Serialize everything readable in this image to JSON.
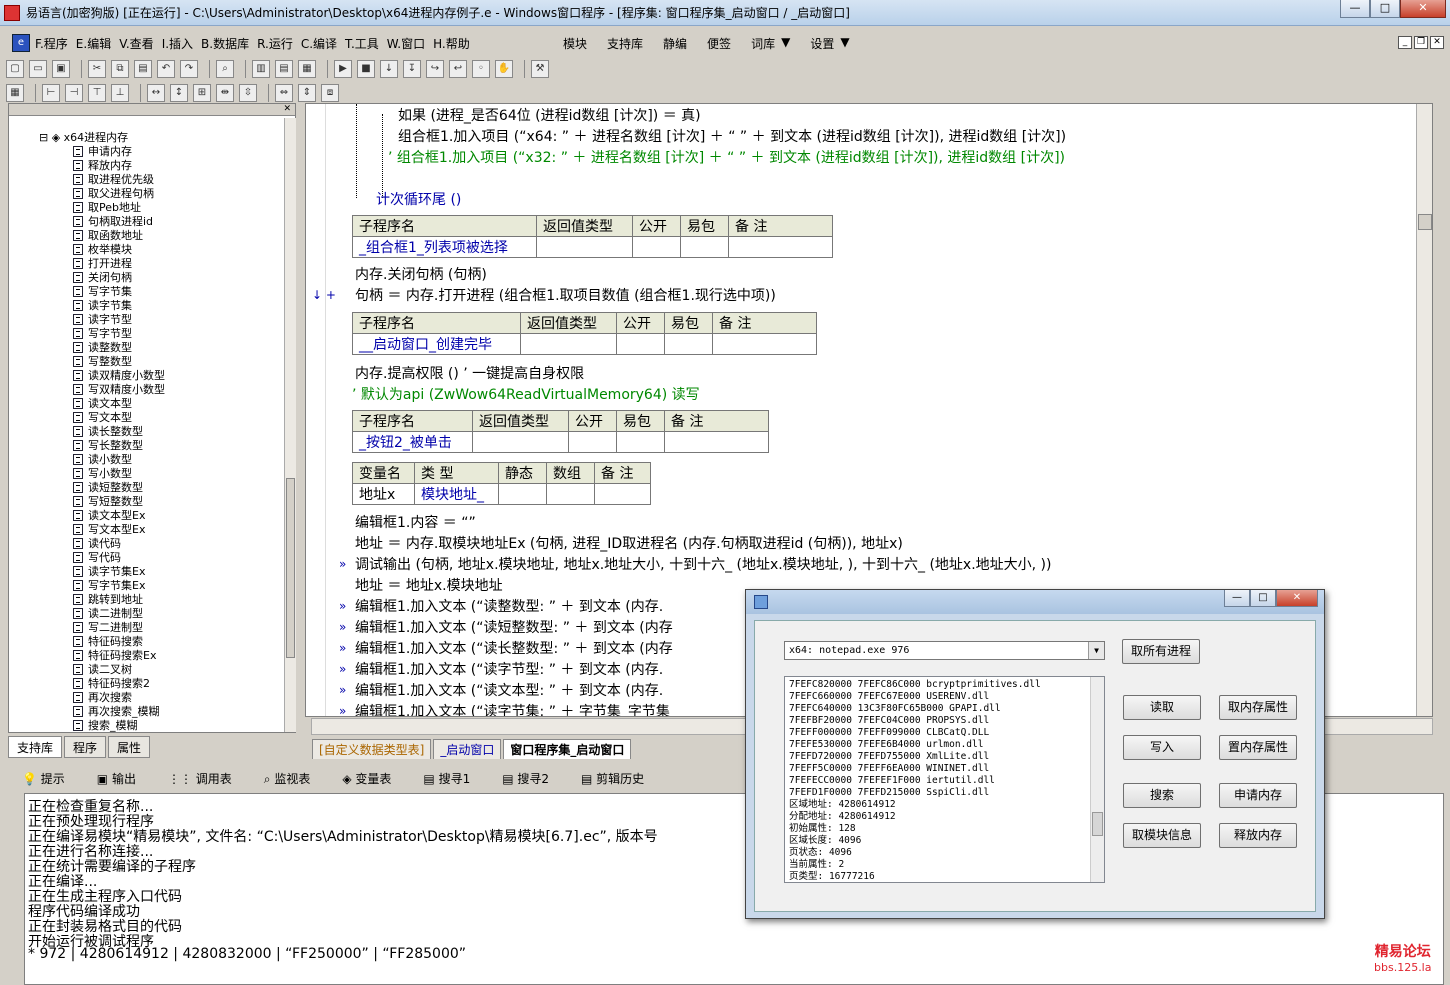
{
  "window": {
    "title": "易语言(加密狗版) [正在运行] - C:\\Users\\Administrator\\Desktop\\x64进程内存例子.e - Windows窗口程序 - [程序集: 窗口程序集_启动窗口 / _启动窗口]",
    "min": "—",
    "max": "□",
    "close": "✕"
  },
  "menu": {
    "items": [
      "F.程序",
      "E.编辑",
      "V.查看",
      "I.插入",
      "B.数据库",
      "R.运行",
      "C.编译",
      "T.工具",
      "W.窗口",
      "H.帮助"
    ],
    "right": [
      "模块",
      "支持库",
      "静编",
      "便签",
      "词库",
      "设置"
    ]
  },
  "sidebar": {
    "root": "x64进程内存",
    "items": [
      "申请内存",
      "释放内存",
      "取进程优先级",
      "取父进程句柄",
      "取Peb地址",
      "句柄取进程id",
      "取函数地址",
      "枚举模块",
      "打开进程",
      "关闭句柄",
      "写字节集",
      "读字节集",
      "读字节型",
      "写字节型",
      "读整数型",
      "写整数型",
      "读双精度小数型",
      "写双精度小数型",
      "读文本型",
      "写文本型",
      "读长整数型",
      "写长整数型",
      "读小数型",
      "写小数型",
      "读短整数型",
      "写短整数型",
      "读文本型Ex",
      "写文本型Ex",
      "读代码",
      "写代码",
      "读字节集Ex",
      "写字节集Ex",
      "跳转到地址",
      "读二进制型",
      "写二进制型",
      "特征码搜索",
      "特征码搜索Ex",
      "读二叉树",
      "特征码搜索2",
      "再次搜索",
      "再次搜索_模糊",
      "搜索_模糊"
    ],
    "tabs": [
      "支持库",
      "程序",
      "属性"
    ]
  },
  "editor": {
    "tabs": [
      "[自定义数据类型表]",
      "_启动窗口",
      "窗口程序集_启动窗口"
    ],
    "headers1": [
      "子程序名",
      "返回值类型",
      "公开",
      "易包",
      "备 注"
    ],
    "headers2": [
      "变量名",
      "类 型",
      "静态",
      "数组",
      "备 注"
    ],
    "sub1": "_组合框1_列表项被选择",
    "sub2": "__启动窗口_创建完毕",
    "sub3": "_按钮2_被单击",
    "var_name": "地址x",
    "var_type": "模块地址_",
    "l_if": "如果 (进程_是否64位 (进程id数组 [计次]) ＝ 真)",
    "l_add1": "组合框1.加入项目 (“x64: ” ＋ 进程名数组 [计次] ＋ “  ” ＋ 到文本 (进程id数组 [计次]), 进程id数组 [计次])",
    "l_add2": "’ 组合框1.加入项目 (“x32: ” ＋ 进程名数组 [计次] ＋ “  ” ＋ 到文本 (进程id数组 [计次]), 进程id数组 [计次])",
    "l_loop": "计次循环尾 ()",
    "l_close": "内存.关闭句柄 (句柄)",
    "l_open": "句柄 ＝ 内存.打开进程 (组合框1.取项目数值 (组合框1.现行选中项))",
    "l_priv": "内存.提高权限 () ’ 一键提高自身权限",
    "l_api": "’ 默认为api (ZwWow64ReadVirtualMemory64) 读写",
    "l_e1": "编辑框1.内容 ＝ “”",
    "l_e2": "地址 ＝ 内存.取模块地址Ex (句柄, 进程_ID取进程名 (内存.句柄取进程id (句柄)), 地址x)",
    "l_e3": "调试输出 (句柄, 地址x.模块地址, 地址x.地址大小, 十到十六_ (地址x.模块地址, ), 十到十六_ (地址x.地址大小, ))",
    "l_e4": "地址 ＝ 地址x.模块地址",
    "l_e5": "编辑框1.加入文本 (“读整数型: ” ＋ 到文本 (内存.",
    "l_e6": "编辑框1.加入文本 (“读短整数型: ” ＋ 到文本 (内存",
    "l_e7": "编辑框1.加入文本 (“读长整数型: ” ＋ 到文本 (内存",
    "l_e8": "编辑框1.加入文本 (“读字节型: ” ＋ 到文本 (内存.",
    "l_e9": "编辑框1.加入文本 (“读文本型: ” ＋ 到文本 (内存.",
    "l_e10": "编辑框1.加入文本 (“读字节集: ” ＋ 字节集_字节集"
  },
  "output": {
    "tabs": [
      "提示",
      "输出",
      "调用表",
      "监视表",
      "变量表",
      "搜寻1",
      "搜寻2",
      "剪辑历史"
    ],
    "lines": [
      "正在检查重复名称...",
      "正在预处理现行程序",
      "正在编译易模块“精易模块”, 文件名: “C:\\Users\\Administrator\\Desktop\\精易模块[6.7].ec”, 版本号",
      "正在进行名称连接...",
      "正在统计需要编译的子程序",
      "正在编译...",
      "正在生成主程序入口代码",
      "程序代码编译成功",
      "正在封装易格式目的代码",
      "开始运行被调试程序",
      "* 972 | 4280614912 | 4280832000 | “FF250000” | “FF285000”"
    ]
  },
  "dialog": {
    "combo": "x64: notepad.exe   976",
    "buttons": [
      "取所有进程",
      "读取",
      "取内存属性",
      "写入",
      "置内存属性",
      "搜索",
      "申请内存",
      "取模块信息",
      "释放内存"
    ],
    "list": [
      "7FEFC820000 7FEFC86C000 bcryptprimitives.dll",
      "7FEFC660000 7FEFC67E000 USERENV.dll",
      "7FEFC640000 13C3F80FC65B000 GPAPI.dll",
      "7FEFBF20000 7FEFC04C000 PROPSYS.dll",
      "7FEFF000000 7FEFF099000 CLBCatQ.DLL",
      "7FEFE530000 7FEFE6B4000 urlmon.dll",
      "7FEFD720000 7FEFD755000 XmlLite.dll",
      "7FEFF5C0000 7FEFF6EA000 WININET.dll",
      "7FEFECC0000 7FEFEF1F000 iertutil.dll",
      "7FEFD1F0000 7FEFD215000 SspiCli.dll",
      "区域地址: 4280614912",
      "分配地址: 4280614912",
      "初始属性: 128",
      "区域长度: 4096",
      "页状态: 4096",
      "当前属性: 2",
      "页类型: 16777216"
    ]
  },
  "watermark": {
    "line1": "精易论坛",
    "line2": "bbs.125.la"
  }
}
